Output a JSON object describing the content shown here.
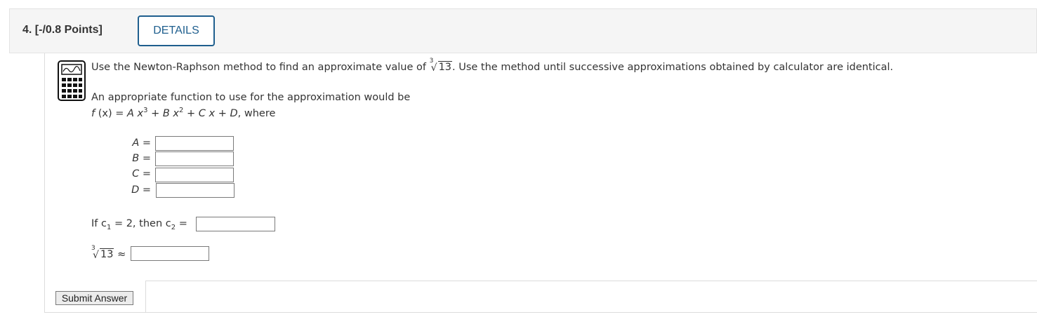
{
  "header": {
    "question_label": "4.  [-/0.8 Points]",
    "details_button": "DETAILS"
  },
  "problem": {
    "intro_before": "Use the Newton-Raphson method to find an approximate value of ",
    "root_index": "3",
    "root_value": "13",
    "intro_after": ". Use the method until successive approximations obtained by calculator are identical.",
    "function_prompt": "An appropriate function to use for the approximation would be",
    "function_text": {
      "f": "f",
      "x_paren": " (x) = ",
      "A": "A",
      "x3": " x",
      "exp3": "3",
      "plusB": " + ",
      "B": "B",
      "x2": " x",
      "exp2": "2",
      "plusC": " + ",
      "C": "C",
      "x1": " x",
      "plusD": " + ",
      "D": "D",
      "where": ", where"
    }
  },
  "fields": {
    "A_label": "A",
    "B_label": "B",
    "C_label": "C",
    "D_label": "D",
    "equals": " =",
    "A_value": "",
    "B_value": "",
    "C_value": "",
    "D_value": ""
  },
  "iteration": {
    "prefix": "If c",
    "sub1": "1",
    "mid": " = 2, then c",
    "sub2": "2",
    "eq": " =",
    "c2_value": ""
  },
  "approx": {
    "root_index": "3",
    "root_value": "13",
    "approx_symbol": "≈",
    "value": ""
  },
  "actions": {
    "submit_label": "Submit Answer"
  },
  "colors": {
    "accent": "#1f5f8e",
    "header_bg": "#f5f5f5"
  },
  "icons": [
    "calculator-icon",
    "radical-icon"
  ]
}
